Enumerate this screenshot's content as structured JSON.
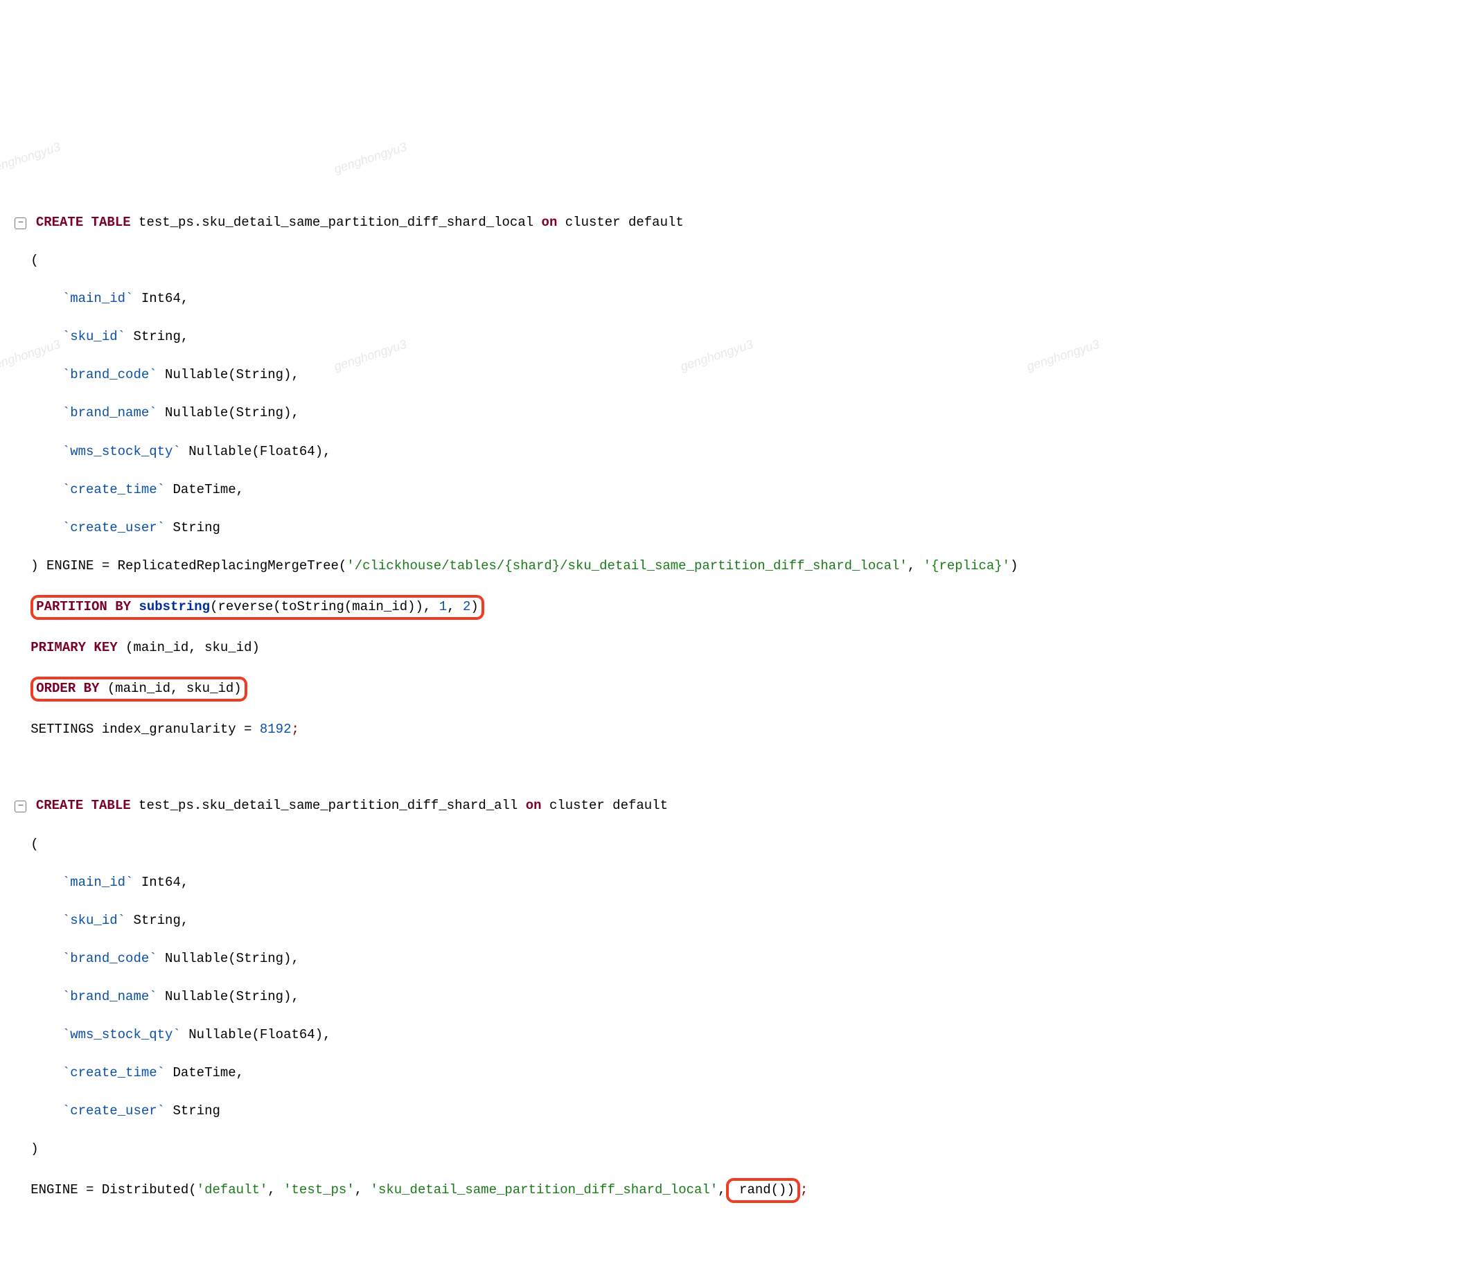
{
  "watermark": "genghongyu3",
  "fold_glyph": "−",
  "stmt1": {
    "kw_create_table": "CREATE TABLE",
    "table_name": " test_ps.sku_detail_same_partition_diff_shard_local ",
    "kw_on": "on",
    "cluster": " cluster default",
    "open_paren": "(",
    "cols": {
      "c1_name": "`main_id`",
      "c1_type": " Int64,",
      "c2_name": "`sku_id`",
      "c2_type": " String,",
      "c3_name": "`brand_code`",
      "c3_type": " Nullable(String),",
      "c4_name": "`brand_name`",
      "c4_type": " Nullable(String),",
      "c5_name": "`wms_stock_qty`",
      "c5_type": " Nullable(Float64),",
      "c6_name": "`create_time`",
      "c6_type": " DateTime,",
      "c7_name": "`create_user`",
      "c7_type": " String"
    },
    "close_engine_prefix": ") ENGINE = ReplicatedReplacingMergeTree(",
    "engine_str1": "'/clickhouse/tables/{shard}/sku_detail_same_partition_diff_shard_local'",
    "engine_comma": ", ",
    "engine_str2": "'{replica}'",
    "engine_close": ")",
    "partition": {
      "kw": "PARTITION BY ",
      "fn": "substring",
      "args_open": "(reverse(toString(main_id)), ",
      "num1": "1",
      "sep": ", ",
      "num2": "2",
      "close": ")"
    },
    "pk_kw": "PRIMARY KEY ",
    "pk_args": "(main_id, sku_id)",
    "orderby_kw": "ORDER BY",
    "orderby_args": " (main_id, sku_id)",
    "settings_prefix": "SETTINGS index_granularity = ",
    "settings_num": "8192",
    "semicolon": ";"
  },
  "stmt2": {
    "kw_create_table": "CREATE TABLE",
    "table_name": " test_ps.sku_detail_same_partition_diff_shard_all ",
    "kw_on": "on",
    "cluster": " cluster default",
    "open_paren": "(",
    "cols": {
      "c1_name": "`main_id`",
      "c1_type": " Int64,",
      "c2_name": "`sku_id`",
      "c2_type": " String,",
      "c3_name": "`brand_code`",
      "c3_type": " Nullable(String),",
      "c4_name": "`brand_name`",
      "c4_type": " Nullable(String),",
      "c5_name": "`wms_stock_qty`",
      "c5_type": " Nullable(Float64),",
      "c6_name": "`create_time`",
      "c6_type": " DateTime,",
      "c7_name": "`create_user`",
      "c7_type": " String"
    },
    "close_paren": ")",
    "engine_prefix": "ENGINE = Distributed(",
    "arg1": "'default'",
    "sep": ", ",
    "arg2": "'test_ps'",
    "arg3": "'sku_detail_same_partition_diff_shard_local'",
    "rand_text": " rand())",
    "semicolon": ";"
  }
}
